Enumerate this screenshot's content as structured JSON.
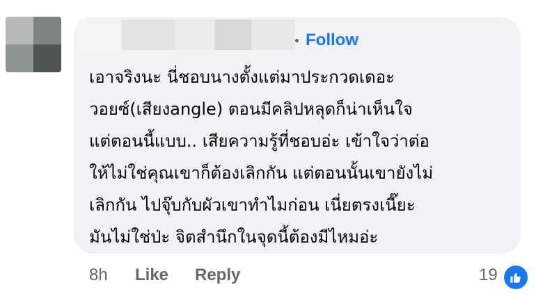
{
  "comment": {
    "follow_label": "Follow",
    "text_lines": [
      "เอาจริงนะ นี่ชอบนางตั้งแต่มาประกวดเดอะ",
      "วอยซ์(เสียงangle) ตอนมีคลิปหลุดก็น่าเห็นใจ",
      "แต่ตอนนี้แบบ.. เสียความรู้ที่ชอบอ่ะ เข้าใจว่าต่อ",
      "ให้ไม่ใช่คุณเขาก็ต้องเลิกกัน แต่ตอนนั้นเขายังไม่",
      "เลิกกัน ไปจุ๊บกับผัวเขาทำไมก่อน เนี่ยตรงเนี๊ยะ",
      "มันไม่ใช่ป่ะ จิตสำนึกในจุดนี้ต้องมีไหมอ่ะ"
    ],
    "timestamp": "8h",
    "like_label": "Like",
    "reply_label": "Reply",
    "reaction_count": "19",
    "reaction_icon": "thumbs-up-icon",
    "accent_color": "#1877f2"
  }
}
